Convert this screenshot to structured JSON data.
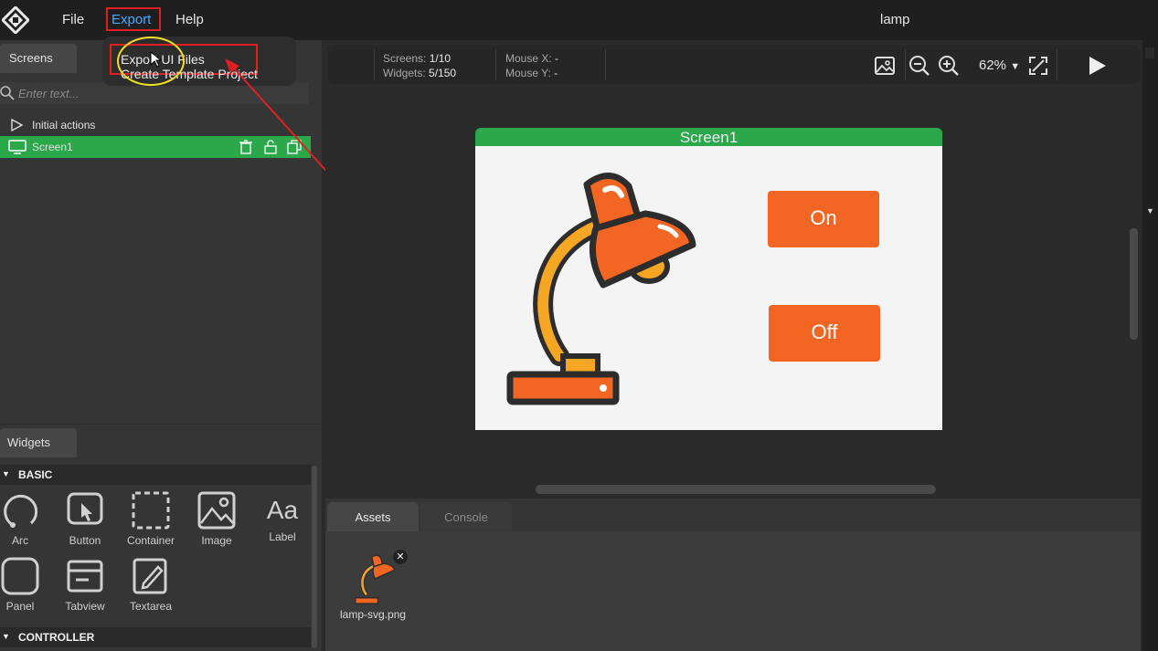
{
  "menubar": {
    "file": "File",
    "export": "Export",
    "help": "Help",
    "title": "lamp"
  },
  "export_menu": {
    "export_ui_files": "Export UI Files",
    "create_template": "Create Template Project"
  },
  "screens_panel": {
    "tab": "Screens",
    "search_placeholder": "Enter text...",
    "items": [
      {
        "label": "Initial actions"
      },
      {
        "label": "Screen1"
      }
    ]
  },
  "widgets_panel": {
    "tab": "Widgets",
    "sections": [
      "BASIC",
      "CONTROLLER"
    ],
    "basic": [
      {
        "label": "Arc",
        "icon": "arc-icon"
      },
      {
        "label": "Button",
        "icon": "button-icon"
      },
      {
        "label": "Container",
        "icon": "container-icon"
      },
      {
        "label": "Image",
        "icon": "image-icon"
      },
      {
        "label": "Label",
        "icon": "label-icon"
      },
      {
        "label": "Panel",
        "icon": "panel-icon"
      },
      {
        "label": "Tabview",
        "icon": "tabview-icon"
      },
      {
        "label": "Textarea",
        "icon": "textarea-icon"
      }
    ],
    "label_glyph": "Aa"
  },
  "toolbar": {
    "screens_label": "Screens:",
    "screens_value": "1/10",
    "widgets_label": "Widgets:",
    "widgets_value": "5/150",
    "mouse_x_label": "Mouse X:",
    "mouse_x_value": "-",
    "mouse_y_label": "Mouse Y:",
    "mouse_y_value": "-",
    "zoom": "62%"
  },
  "canvas": {
    "screen_name": "Screen1",
    "on_button": "On",
    "off_button": "Off"
  },
  "bottom_panel": {
    "tabs": [
      "Assets",
      "Console"
    ],
    "assets": [
      {
        "name": "lamp-svg.png"
      }
    ]
  },
  "colors": {
    "accent_green": "#2aa84a",
    "button_orange": "#f26522",
    "highlight_red": "#e02020",
    "cursor_yellow": "#f0e020"
  }
}
